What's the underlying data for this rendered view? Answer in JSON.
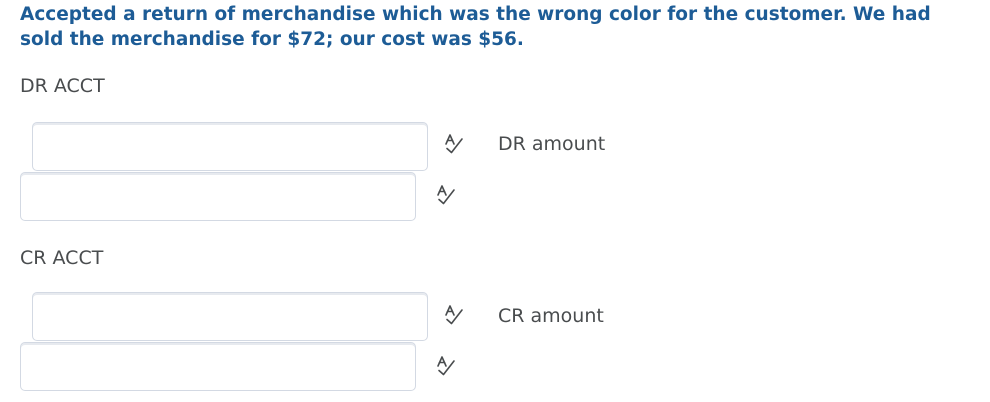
{
  "question": {
    "text": "Accepted a return of merchandise which was the wrong color for the customer. We had sold the merchandise for $72; our cost was $56."
  },
  "debit": {
    "label": "DR ACCT",
    "account_value": "",
    "amount_value": "",
    "amount_label": "DR amount",
    "icon_account": "spell-check-icon",
    "icon_amount": "spell-check-icon"
  },
  "credit": {
    "label": "CR ACCT",
    "account_value": "",
    "amount_value": "",
    "amount_label": "CR amount",
    "icon_account": "spell-check-icon",
    "icon_amount": "spell-check-icon"
  },
  "colors": {
    "question_text": "#1d5c96",
    "body_text": "#494c4e",
    "field_border": "#d3d9e3",
    "icon": "#494c4e"
  }
}
